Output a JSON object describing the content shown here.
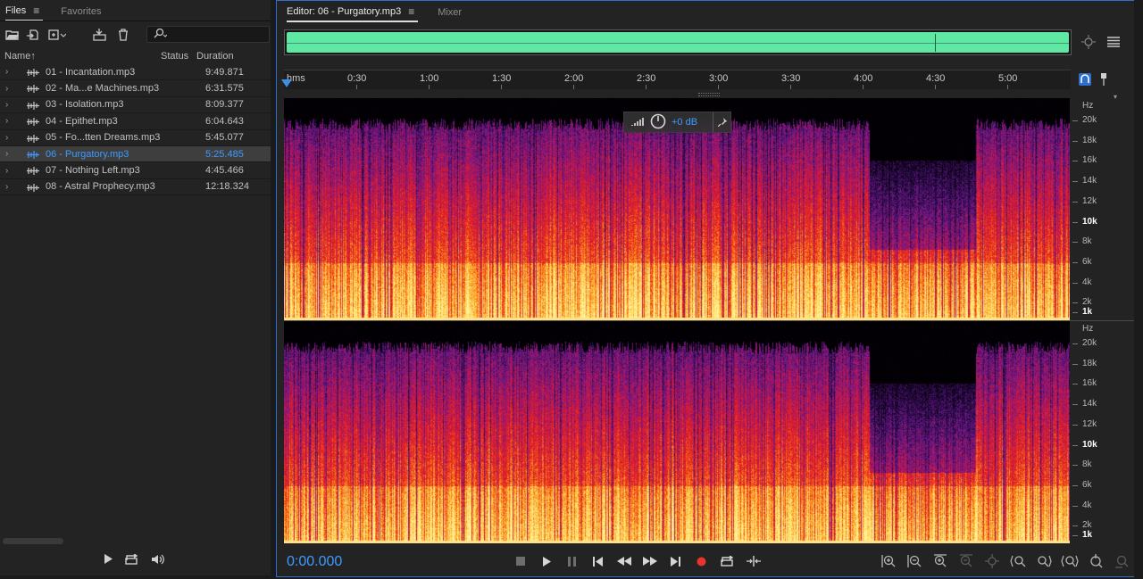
{
  "files_panel": {
    "tabs": [
      {
        "label": "Files",
        "active": true
      },
      {
        "label": "Favorites",
        "active": false
      }
    ],
    "search_placeholder": "",
    "columns": {
      "name": "Name",
      "sort_arrow": "↑",
      "status": "Status",
      "duration": "Duration"
    },
    "files": [
      {
        "name": "01 - Incantation.mp3",
        "duration": "9:49.871",
        "selected": false
      },
      {
        "name": "02 - Ma...e Machines.mp3",
        "duration": "6:31.575",
        "selected": false
      },
      {
        "name": "03 - Isolation.mp3",
        "duration": "8:09.377",
        "selected": false
      },
      {
        "name": "04 - Epithet.mp3",
        "duration": "6:04.643",
        "selected": false
      },
      {
        "name": "05 - Fo...tten Dreams.mp3",
        "duration": "5:45.077",
        "selected": false
      },
      {
        "name": "06 - Purgatory.mp3",
        "duration": "5:25.485",
        "selected": true
      },
      {
        "name": "07 - Nothing Left.mp3",
        "duration": "4:45.466",
        "selected": false
      },
      {
        "name": "08 - Astral Prophecy.mp3",
        "duration": "12:18.324",
        "selected": false
      }
    ]
  },
  "editor": {
    "tabs": [
      {
        "label": "Editor: 06 - Purgatory.mp3",
        "active": true
      },
      {
        "label": "Mixer",
        "active": false
      }
    ],
    "ruler": {
      "unit_label": "hms",
      "ticks": [
        "0:30",
        "1:00",
        "1:30",
        "2:00",
        "2:30",
        "3:00",
        "3:30",
        "4:00",
        "4:30",
        "5:00"
      ]
    },
    "hud": {
      "gain": "+0 dB"
    },
    "frequency_scale": {
      "unit": "Hz",
      "labels": [
        "20k",
        "18k",
        "16k",
        "14k",
        "12k",
        "10k",
        "8k",
        "6k",
        "4k",
        "2k",
        "1k"
      ],
      "bold_labels": [
        "10k",
        "1k"
      ]
    },
    "timecode": "0:00.000"
  },
  "colors": {
    "accent": "#3d9bff",
    "waveform": "#5fe8a4",
    "panel_border_active": "#2e6fcf",
    "record": "#e8332e"
  }
}
